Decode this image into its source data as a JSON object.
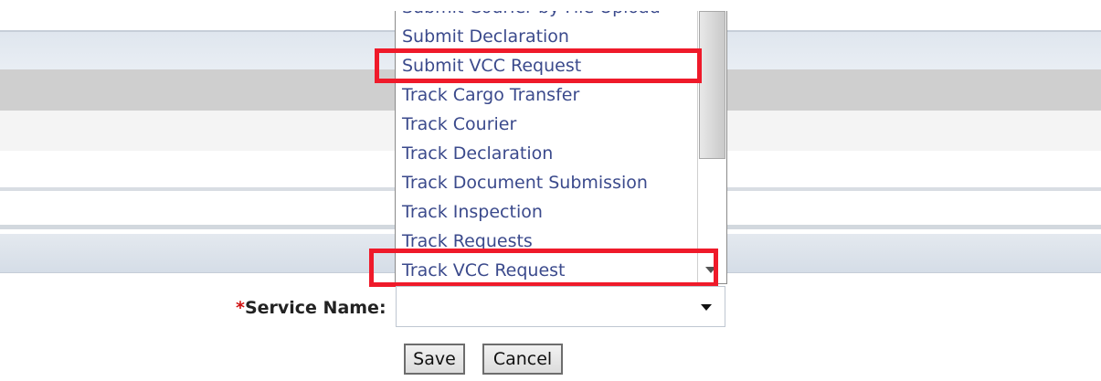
{
  "dropdown": {
    "items": [
      {
        "label": "Submit Courier by File Upload"
      },
      {
        "label": "Submit Declaration"
      },
      {
        "label": "Submit VCC Request"
      },
      {
        "label": "Track Cargo Transfer"
      },
      {
        "label": "Track Courier"
      },
      {
        "label": "Track Declaration"
      },
      {
        "label": "Track Document Submission"
      },
      {
        "label": "Track Inspection"
      },
      {
        "label": "Track Requests"
      },
      {
        "label": "Track VCC Request"
      }
    ],
    "highlighted_items": [
      "Submit VCC Request",
      "Track VCC Request"
    ],
    "highlight_color": "#ef1a2a"
  },
  "form": {
    "required_marker": "*",
    "service_label": "Service Name:",
    "service_value": ""
  },
  "buttons": {
    "save_label": "Save",
    "cancel_label": "Cancel"
  },
  "colors": {
    "item_text": "#3b4a8c",
    "required": "#d01010"
  }
}
